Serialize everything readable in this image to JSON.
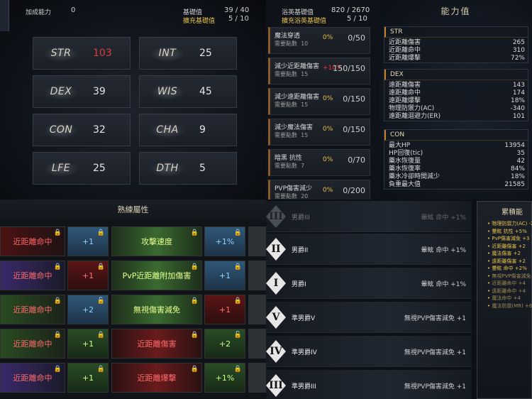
{
  "q1": {
    "bonus_label": "加成能力",
    "bonus_value": "0",
    "base_label": "基礎值",
    "base_value": "39 / 40",
    "extra_label": "擴充基礎值",
    "extra_value": "5 / 10",
    "stats": [
      {
        "name": "STR",
        "value": "103",
        "highlight": true
      },
      {
        "name": "INT",
        "value": "25"
      },
      {
        "name": "DEX",
        "value": "39"
      },
      {
        "name": "WIS",
        "value": "45"
      },
      {
        "name": "CON",
        "value": "32"
      },
      {
        "name": "CHA",
        "value": "9"
      },
      {
        "name": "LFE",
        "value": "25"
      },
      {
        "name": "DTH",
        "value": "5"
      }
    ]
  },
  "q2": {
    "left_header": {
      "base_label": "浴英基礎值",
      "base_value": "820 / 2670",
      "extra_label": "擴充浴英基礎值",
      "extra_value": "5 / 10"
    },
    "perks": [
      {
        "name": "魔法穿透",
        "sub": "需要點數",
        "pts": "10",
        "pct": "0%",
        "count": "0/50",
        "red": false
      },
      {
        "name": "減少近距離傷害",
        "sub": "需要點數",
        "pts": "15",
        "pct": "+10%",
        "count": "150/150",
        "red": true
      },
      {
        "name": "減少遠距離傷害",
        "sub": "需要點數",
        "pts": "15",
        "pct": "0%",
        "count": "0/150",
        "red": false
      },
      {
        "name": "減少魔法傷害",
        "sub": "需要點數",
        "pts": "15",
        "pct": "0%",
        "count": "0/150",
        "red": false
      },
      {
        "name": "暗黑 抗性",
        "sub": "需要點數",
        "pts": "7",
        "pct": "0%",
        "count": "0/70",
        "red": false
      },
      {
        "name": "PVP傷害減少",
        "sub": "需要點數",
        "pts": "20",
        "pct": "0%",
        "count": "0/200",
        "red": false
      }
    ],
    "title": "能力值",
    "sections": [
      {
        "header": "STR",
        "rows": [
          [
            "近距離傷害",
            "265"
          ],
          [
            "近距離命中",
            "310"
          ],
          [
            "近距離爆擊",
            "72%"
          ]
        ]
      },
      {
        "header": "DEX",
        "rows": [
          [
            "遠距離傷害",
            "143"
          ],
          [
            "遠距離命中",
            "174"
          ],
          [
            "遠距離爆擊",
            "18%"
          ],
          [
            "物理防禦力(AC)",
            "-340"
          ],
          [
            "遠距離迴避力(ER)",
            "101"
          ]
        ]
      },
      {
        "header": "CON",
        "rows": [
          [
            "最大HP",
            "13954"
          ],
          [
            "HP回復(tic)",
            "35"
          ],
          [
            "藥水恢復量",
            "42"
          ],
          [
            "藥水恢復率",
            "84%"
          ],
          [
            "藥水冷卻時間減少",
            "18%"
          ],
          [
            "負重最大值",
            "21585"
          ]
        ]
      }
    ]
  },
  "q3": {
    "title": "熟練屬性",
    "rows": [
      {
        "a": "近距離命中",
        "a_style": "c-red",
        "b": "+1",
        "b_style": "c-blue",
        "c": "攻擊速度",
        "c_style": "c-greenwide",
        "d": "+1%",
        "d_style": "c-blue",
        "b_open": false,
        "d_open": false
      },
      {
        "a": "近距離命中",
        "a_style": "c-purple",
        "b": "+1",
        "b_style": "c-dred",
        "c": "PvP近距離附加傷害",
        "c_style": "c-greenwide",
        "d": "+1",
        "d_style": "c-blue",
        "b_open": false,
        "d_open": false
      },
      {
        "a": "近距離命中",
        "a_style": "c-green",
        "b": "+2",
        "b_style": "c-blue",
        "c": "無視傷害減免",
        "c_style": "c-greenwide",
        "d": "+1",
        "d_style": "c-dred",
        "b_open": true,
        "d_open": false
      },
      {
        "a": "近距離命中",
        "a_style": "c-green",
        "b": "+1",
        "b_style": "c-dgreen",
        "c": "近距離傷害",
        "c_style": "c-redwide",
        "d": "+2",
        "d_style": "c-dgreen",
        "b_open": false,
        "d_open": true
      },
      {
        "a": "近距離命中",
        "a_style": "c-purple",
        "b": "+1",
        "b_style": "c-dgreen",
        "c": "近距離爆擊",
        "c_style": "c-redwide",
        "d": "+1%",
        "d_style": "c-dgreen",
        "b_open": false,
        "d_open": false
      }
    ]
  },
  "q4": {
    "ranks": [
      {
        "numeral": "III",
        "name": "男爵III",
        "effect": "暈眩 命中 +1%",
        "dim": true
      },
      {
        "numeral": "II",
        "name": "男爵II",
        "effect": "暈眩 命中 +1%",
        "dim": false
      },
      {
        "numeral": "I",
        "name": "男爵I",
        "effect": "暈眩 命中 +1%",
        "dim": false
      },
      {
        "numeral": "V",
        "name": "準男爵V",
        "effect": "無視PVP傷害減免 +1",
        "dim": false
      },
      {
        "numeral": "IV",
        "name": "準男爵IV",
        "effect": "無視PVP傷害減免 +1",
        "dim": false
      },
      {
        "numeral": "III",
        "name": "準男爵III",
        "effect": "無視PVP傷害減免 +1",
        "dim": false
      }
    ],
    "panel_title": "累積能",
    "panel_items": [
      "物理防禦力(AC) -2",
      "暈眩 抗性 +5%",
      "PvP傷害減免 +3",
      "近距離傷害 +2",
      "魔法傷害 +2",
      "遠距離傷害 +2",
      "暈眩 命中 +2%",
      "無視PVP傷害減免 +",
      "近距離命中 +4",
      "遠距離命中 +4",
      "魔法命中 +4",
      "魔法防禦(MR) +6"
    ]
  }
}
